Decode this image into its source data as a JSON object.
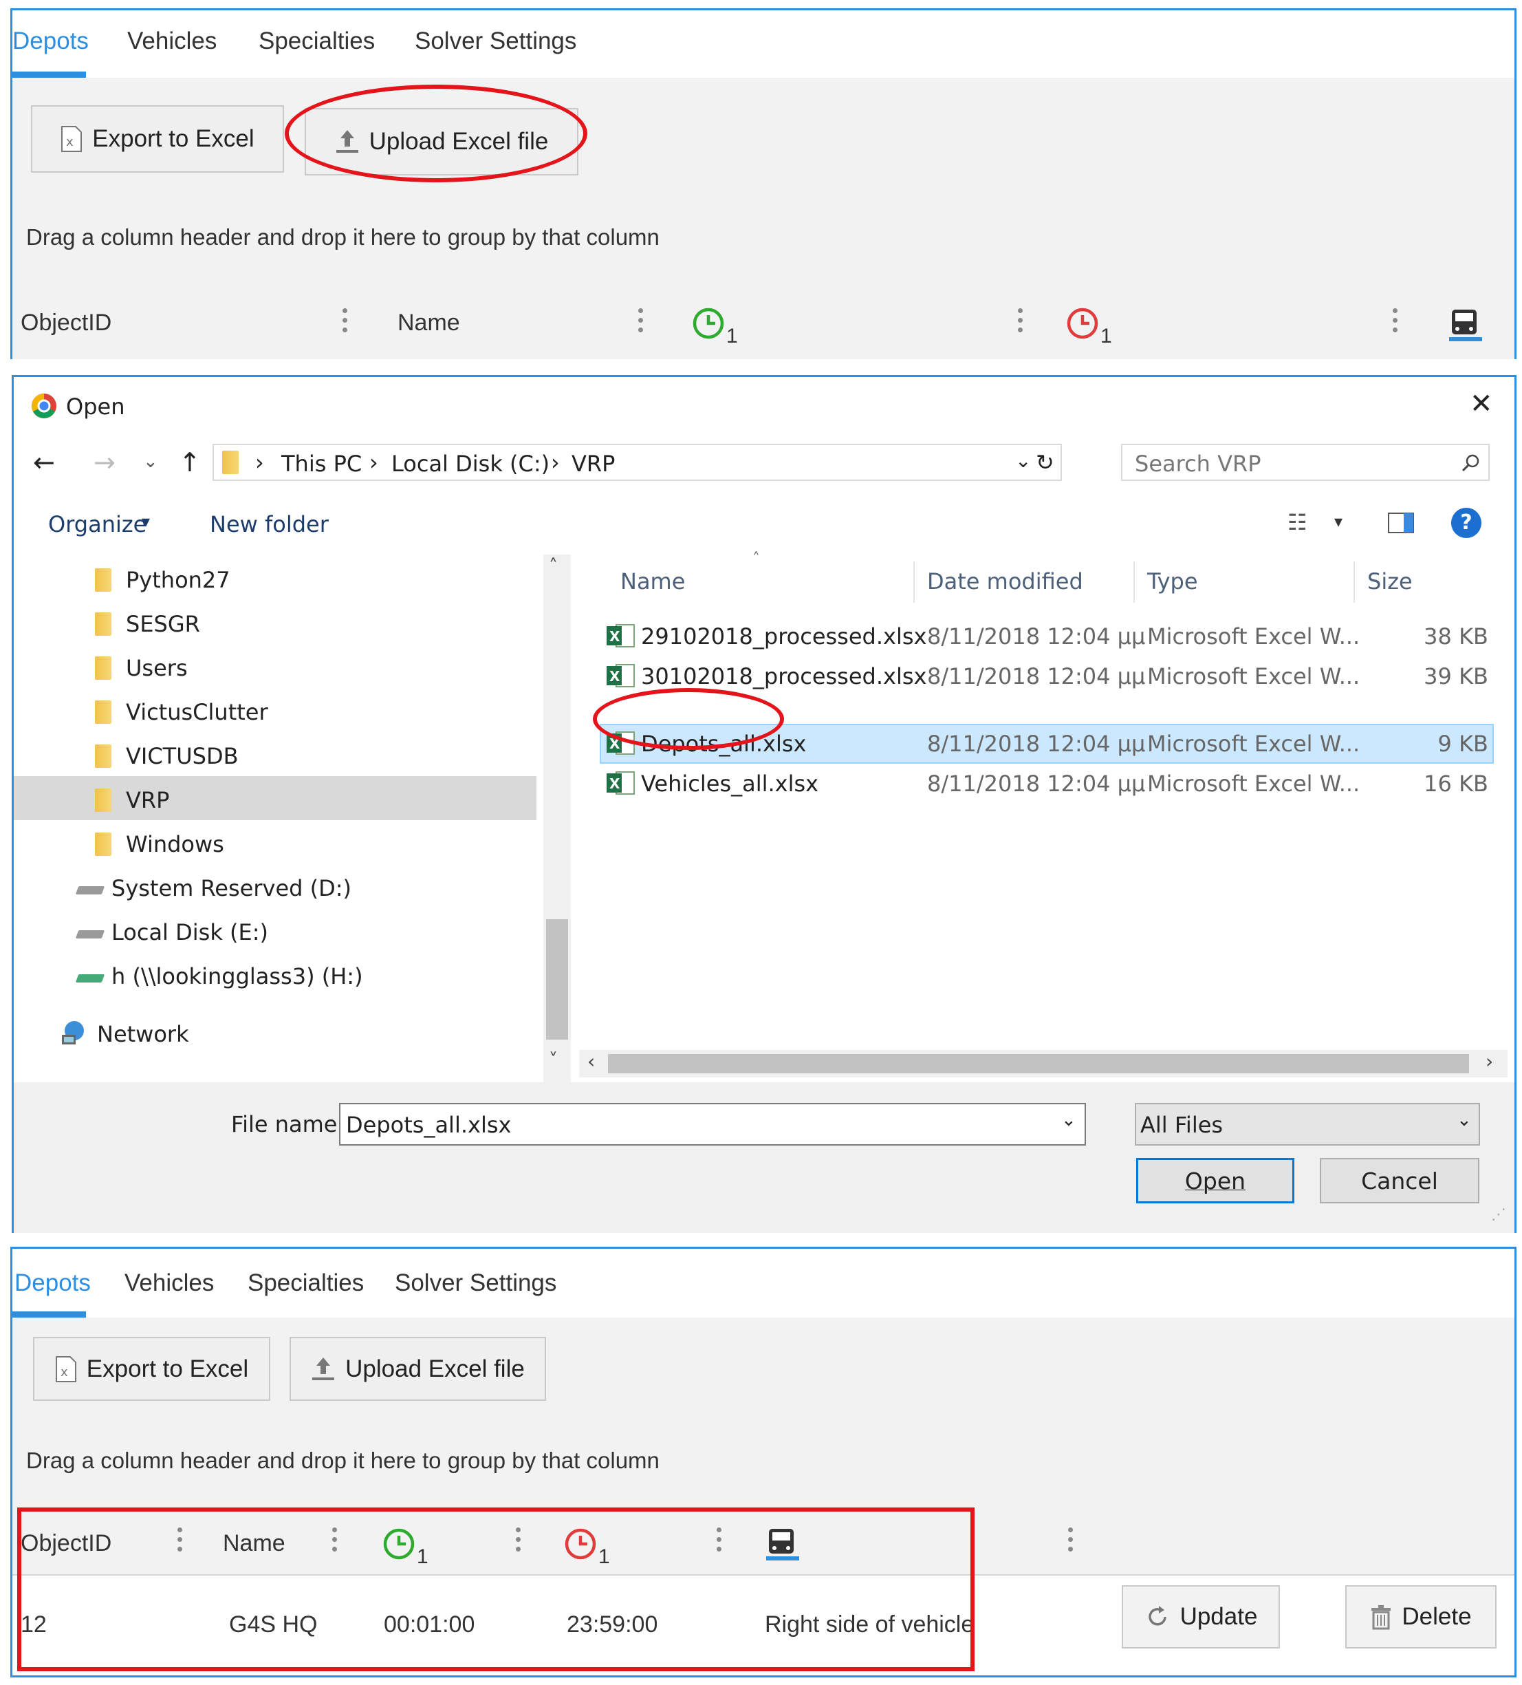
{
  "top_panel": {
    "tabs": [
      "Depots",
      "Vehicles",
      "Specialties",
      "Solver Settings"
    ],
    "export_label": "Export to Excel",
    "upload_label": "Upload Excel file",
    "group_hint": "Drag a column header and drop it here to group by that column",
    "columns": {
      "objectid": "ObjectID",
      "name": "Name",
      "time_start_sub": "1",
      "time_end_sub": "1"
    }
  },
  "dialog": {
    "title": "Open",
    "breadcrumb": [
      "This PC",
      "Local Disk (C:)",
      "VRP"
    ],
    "search_placeholder": "Search VRP",
    "organize_label": "Organize",
    "new_folder_label": "New folder",
    "tree": [
      {
        "label": "Python27",
        "kind": "folder"
      },
      {
        "label": "SESGR",
        "kind": "folder"
      },
      {
        "label": "Users",
        "kind": "folder"
      },
      {
        "label": "VictusClutter",
        "kind": "folder"
      },
      {
        "label": "VICTUSDB",
        "kind": "folder"
      },
      {
        "label": "VRP",
        "kind": "folder",
        "selected": true
      },
      {
        "label": "Windows",
        "kind": "folder"
      },
      {
        "label": "System Reserved (D:)",
        "kind": "drive"
      },
      {
        "label": "Local Disk (E:)",
        "kind": "drive"
      },
      {
        "label": "h (\\\\lookingglass3) (H:)",
        "kind": "network-drive"
      },
      {
        "label": "Network",
        "kind": "network"
      }
    ],
    "file_columns": {
      "name": "Name",
      "date": "Date modified",
      "type": "Type",
      "size": "Size"
    },
    "files": [
      {
        "name": "29102018_processed.xlsx",
        "date": "8/11/2018 12:04 μμ",
        "type": "Microsoft Excel W...",
        "size": "38 KB"
      },
      {
        "name": "30102018_processed.xlsx",
        "date": "8/11/2018 12:04 μμ",
        "type": "Microsoft Excel W...",
        "size": "39 KB"
      },
      {
        "name": "Depots_all.xlsx",
        "date": "8/11/2018 12:04 μμ",
        "type": "Microsoft Excel W...",
        "size": "9 KB",
        "selected": true
      },
      {
        "name": "Vehicles_all.xlsx",
        "date": "8/11/2018 12:04 μμ",
        "type": "Microsoft Excel W...",
        "size": "16 KB"
      }
    ],
    "filename_label": "File name:",
    "filename_value": "Depots_all.xlsx",
    "filetype_value": "All Files",
    "open_label": "Open",
    "cancel_label": "Cancel"
  },
  "bottom_panel": {
    "tabs": [
      "Depots",
      "Vehicles",
      "Specialties",
      "Solver Settings"
    ],
    "export_label": "Export to Excel",
    "upload_label": "Upload Excel file",
    "group_hint": "Drag a column header and drop it here to group by that column",
    "columns": {
      "objectid": "ObjectID",
      "name": "Name",
      "time_start_sub": "1",
      "time_end_sub": "1"
    },
    "row": {
      "objectid": "12",
      "name": "G4S HQ",
      "start": "00:01:00",
      "end": "23:59:00",
      "side": "Right side of vehicle"
    },
    "update_label": "Update",
    "delete_label": "Delete"
  },
  "colors": {
    "accent": "#2e8fe0",
    "annotation": "#e4141b",
    "clock_start": "#2eaa2e",
    "clock_end": "#e03c3c"
  }
}
